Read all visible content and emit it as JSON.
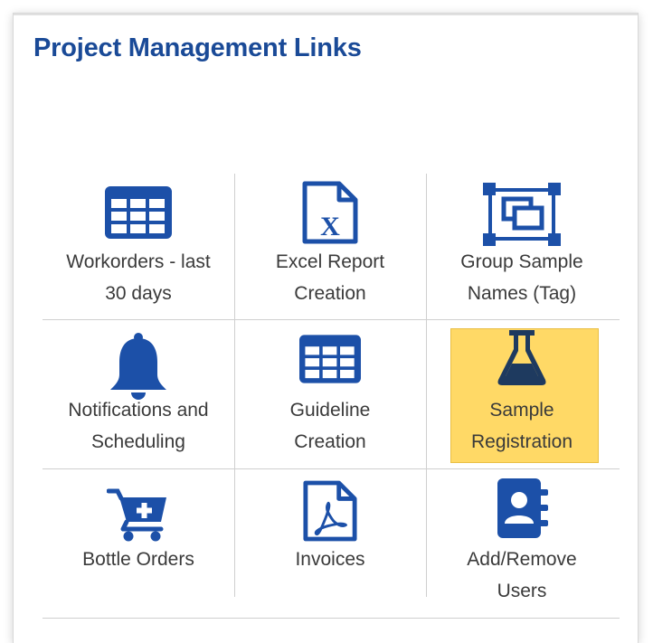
{
  "panel": {
    "title": "Project Management Links"
  },
  "colors": {
    "icon_blue": "#1c50a8",
    "title_blue": "#1a4a97",
    "highlight": "#ffd966",
    "flask": "#1e3a5f"
  },
  "tiles": [
    {
      "label_line1": "Workorders - last",
      "label_line2": "30 days",
      "icon": "table-grid-icon"
    },
    {
      "label_line1": "Excel Report",
      "label_line2": "Creation",
      "icon": "excel-file-icon"
    },
    {
      "label_line1": "Group Sample",
      "label_line2": "Names (Tag)",
      "icon": "group-objects-icon"
    },
    {
      "label_line1": "Notifications and",
      "label_line2": "Scheduling",
      "icon": "bell-icon"
    },
    {
      "label_line1": "Guideline",
      "label_line2": "Creation",
      "icon": "table-grid-icon"
    },
    {
      "label_line1": "Sample",
      "label_line2": "Registration",
      "icon": "flask-icon",
      "selected": true
    },
    {
      "label_line1": "Bottle Orders",
      "label_line2": "",
      "icon": "cart-plus-icon"
    },
    {
      "label_line1": "Invoices",
      "label_line2": "",
      "icon": "pdf-file-icon"
    },
    {
      "label_line1": "Add/Remove",
      "label_line2": "Users",
      "icon": "address-book-icon"
    }
  ]
}
